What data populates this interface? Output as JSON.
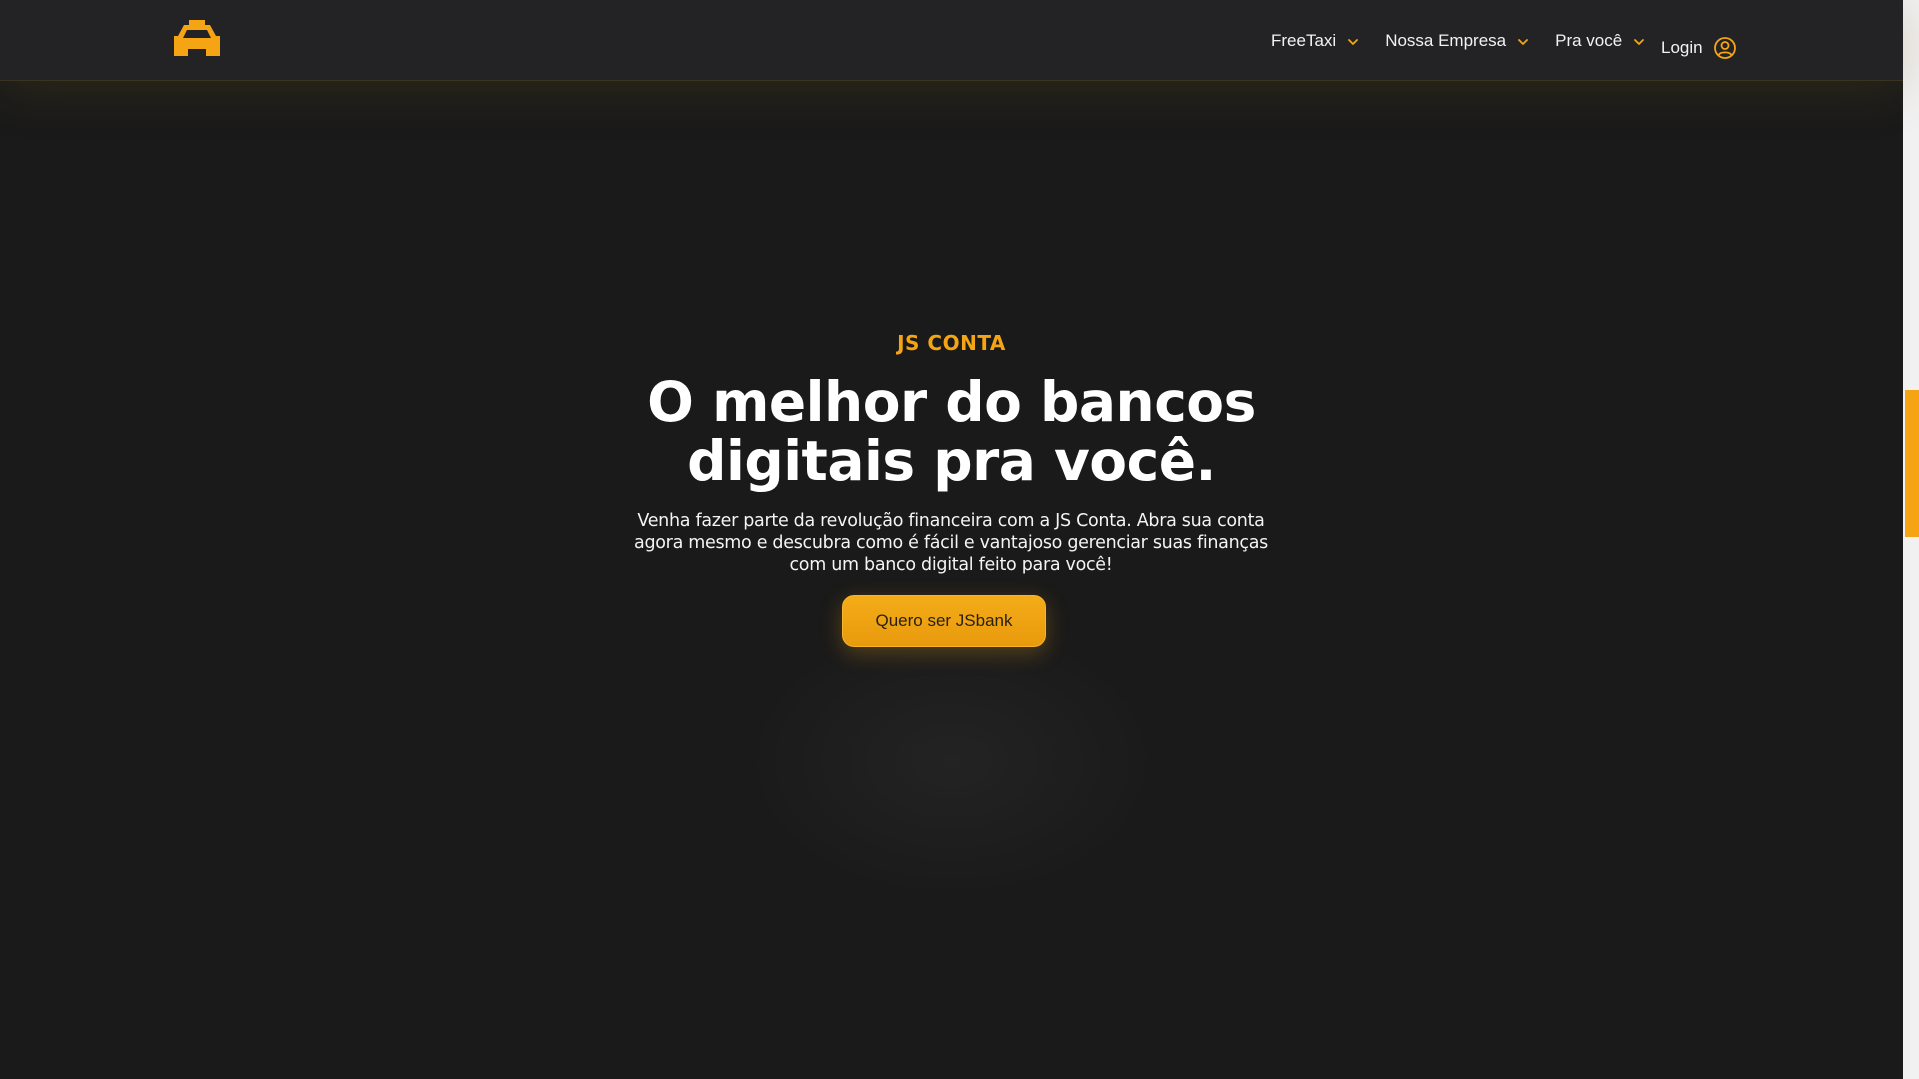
{
  "header": {
    "logo_icon": "taxi-logo-icon",
    "nav": [
      {
        "label": "FreeTaxi",
        "icon": "chevron-down-icon"
      },
      {
        "label": "Nossa Empresa",
        "icon": "chevron-down-icon"
      },
      {
        "label": "Pra você",
        "icon": "chevron-down-icon"
      }
    ],
    "login": {
      "label": "Login",
      "icon": "user-circle-icon"
    }
  },
  "hero": {
    "eyebrow": "JS CONTA",
    "title_line1": "O melhor do bancos",
    "title_line2": "digitais pra você.",
    "subtitle_line1": "Venha fazer parte da revolução financeira com a JS Conta. Abra sua conta",
    "subtitle_line2": "agora mesmo e descubra como é fácil e vantajoso gerenciar suas finanças",
    "subtitle_line3": "com um banco digital feito para você!",
    "cta_label": "Quero ser JSbank"
  },
  "colors": {
    "background": "#1a1a1a",
    "header": "#232325",
    "accent": "#f5a514",
    "text": "#ffffff"
  }
}
